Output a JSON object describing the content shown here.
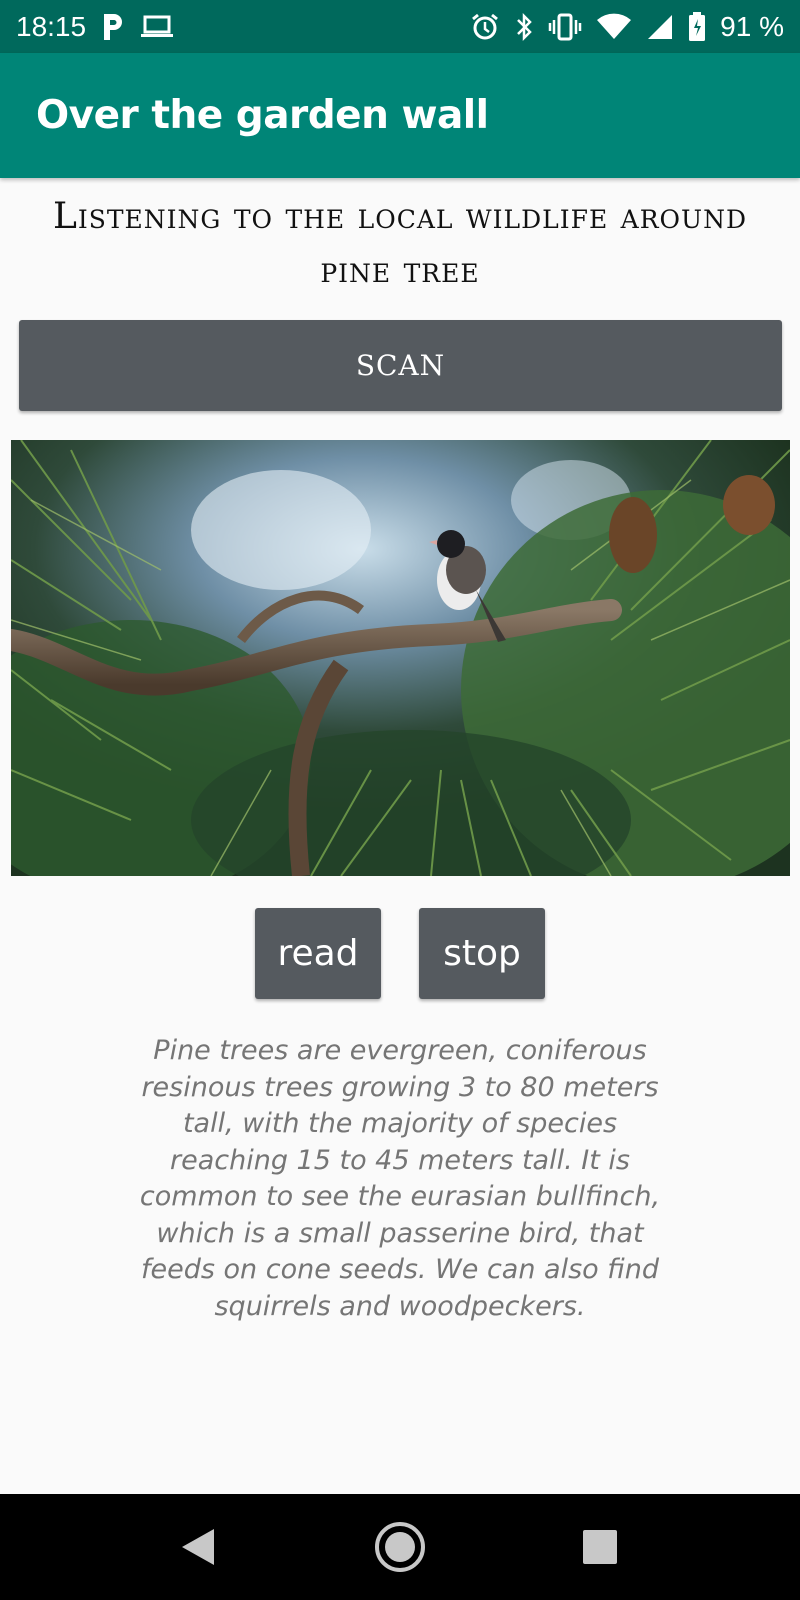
{
  "status_bar": {
    "time": "18:15",
    "battery": "91 %",
    "icons": [
      "parking-icon",
      "laptop-icon",
      "alarm-icon",
      "bluetooth-icon",
      "vibrate-icon",
      "wifi-icon",
      "signal-icon",
      "battery-icon"
    ]
  },
  "app_bar": {
    "title": "Over the garden wall"
  },
  "main": {
    "headline": "Listening to the local wildlife around pine tree",
    "scan_label": "SCAN",
    "photo": "bird-on-pine-branch-image",
    "read_label": "read",
    "stop_label": "stop",
    "description": "Pine trees are evergreen, coniferous resinous trees growing 3 to 80 meters tall, with the majority of species reaching 15 to 45 meters tall. It is common to see the eurasian bullfinch, which is a small passerine bird, that feeds on cone seeds. We can also find squirrels and woodpeckers."
  },
  "nav_bar": {
    "icons": [
      "back-icon",
      "home-icon",
      "recents-icon"
    ]
  },
  "colors": {
    "status_bar": "#00695c",
    "app_bar": "#008577",
    "button": "#555a5f",
    "background": "#fafafa",
    "description_text": "#757575"
  }
}
